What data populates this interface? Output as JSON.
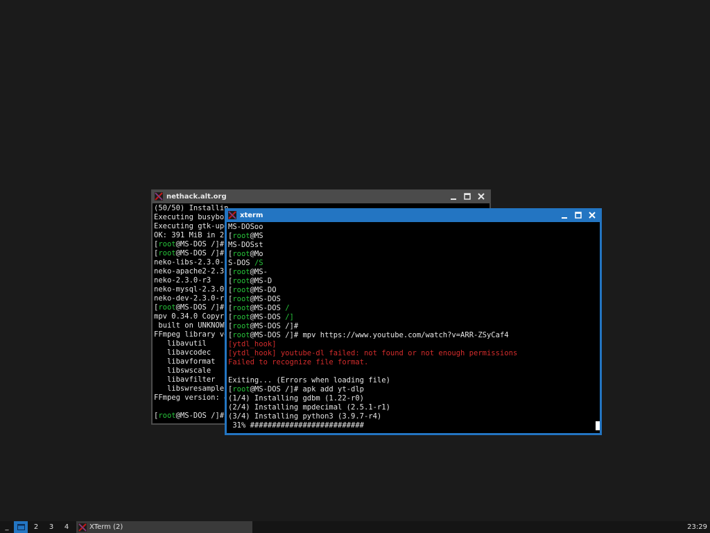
{
  "windows": {
    "back": {
      "title": "nethack.alt.org",
      "lines": [
        [
          {
            "t": "(50/50) Installin"
          }
        ],
        [
          {
            "t": "Executing busybox"
          }
        ],
        [
          {
            "t": "Executing gtk-upd"
          }
        ],
        [
          {
            "t": "OK: 391 MiB in 21"
          }
        ],
        [
          {
            "t": "["
          },
          {
            "t": "root",
            "c": "g"
          },
          {
            "t": "@MS-DOS /]#"
          }
        ],
        [
          {
            "t": "["
          },
          {
            "t": "root",
            "c": "g"
          },
          {
            "t": "@MS-DOS /]#"
          }
        ],
        [
          {
            "t": "neko-libs-2.3.0-r"
          }
        ],
        [
          {
            "t": "neko-apache2-2.3."
          }
        ],
        [
          {
            "t": "neko-2.3.0-r3"
          }
        ],
        [
          {
            "t": "neko-mysql-2.3.0-"
          }
        ],
        [
          {
            "t": "neko-dev-2.3.0-r3"
          }
        ],
        [
          {
            "t": "["
          },
          {
            "t": "root",
            "c": "g"
          },
          {
            "t": "@MS-DOS /]#"
          }
        ],
        [
          {
            "t": "mpv 0.34.0 Copyri"
          }
        ],
        [
          {
            "t": " built on UNKNOWN"
          }
        ],
        [
          {
            "t": "FFmpeg library ve"
          }
        ],
        [
          {
            "t": "   libavutil"
          }
        ],
        [
          {
            "t": "   libavcodec"
          }
        ],
        [
          {
            "t": "   libavformat"
          }
        ],
        [
          {
            "t": "   libswscale"
          }
        ],
        [
          {
            "t": "   libavfilter"
          }
        ],
        [
          {
            "t": "   libswresample"
          }
        ],
        [
          {
            "t": "FFmpeg version: 4"
          }
        ],
        [
          {
            "t": ""
          }
        ],
        [
          {
            "t": "["
          },
          {
            "t": "root",
            "c": "g"
          },
          {
            "t": "@MS-DOS /]#"
          }
        ]
      ]
    },
    "front": {
      "title": "xterm",
      "lines": [
        [
          {
            "t": "MS-DOSoo"
          }
        ],
        [
          {
            "t": "["
          },
          {
            "t": "root",
            "c": "g"
          },
          {
            "t": "@MS"
          }
        ],
        [
          {
            "t": "MS-DOSst"
          }
        ],
        [
          {
            "t": "["
          },
          {
            "t": "root",
            "c": "g"
          },
          {
            "t": "@Mo"
          }
        ],
        [
          {
            "t": "S-DOS "
          },
          {
            "t": "/S",
            "c": "g"
          }
        ],
        [
          {
            "t": "["
          },
          {
            "t": "root",
            "c": "g"
          },
          {
            "t": "@MS-"
          }
        ],
        [
          {
            "t": "["
          },
          {
            "t": "root",
            "c": "g"
          },
          {
            "t": "@MS-D"
          }
        ],
        [
          {
            "t": "["
          },
          {
            "t": "root",
            "c": "g"
          },
          {
            "t": "@MS-DO"
          }
        ],
        [
          {
            "t": "["
          },
          {
            "t": "root",
            "c": "g"
          },
          {
            "t": "@MS-DOS"
          }
        ],
        [
          {
            "t": "["
          },
          {
            "t": "root",
            "c": "g"
          },
          {
            "t": "@MS-DOS "
          },
          {
            "t": "/",
            "c": "g"
          }
        ],
        [
          {
            "t": "["
          },
          {
            "t": "root",
            "c": "g"
          },
          {
            "t": "@MS-DOS "
          },
          {
            "t": "/]",
            "c": "g"
          }
        ],
        [
          {
            "t": "["
          },
          {
            "t": "root",
            "c": "g"
          },
          {
            "t": "@MS-DOS /]#"
          }
        ],
        [
          {
            "t": "["
          },
          {
            "t": "root",
            "c": "g"
          },
          {
            "t": "@MS-DOS /]# mpv https://www.youtube.com/watch?v=ARR-ZSyCaf4"
          }
        ],
        [
          {
            "t": "[ytdl_hook]",
            "c": "r"
          }
        ],
        [
          {
            "t": "[ytdl_hook] youtube-dl failed: not found or not enough permissions",
            "c": "r"
          }
        ],
        [
          {
            "t": "Failed to recognize file format.",
            "c": "r"
          }
        ],
        [
          {
            "t": ""
          }
        ],
        [
          {
            "t": "Exiting... (Errors when loading file)"
          }
        ],
        [
          {
            "t": "["
          },
          {
            "t": "root",
            "c": "g"
          },
          {
            "t": "@MS-DOS /]# apk add yt-dlp"
          }
        ],
        [
          {
            "t": "(1/4) Installing gdbm (1.22-r0)"
          }
        ],
        [
          {
            "t": "(2/4) Installing mpdecimal (2.5.1-r1)"
          }
        ],
        [
          {
            "t": "(3/4) Installing python3 (3.9.7-r4)"
          }
        ],
        [
          {
            "t": " 31% ##########################"
          }
        ]
      ]
    }
  },
  "taskbar": {
    "minimize_label": "_",
    "workspaces": [
      {
        "label": "",
        "active": true,
        "icon": "window-icon"
      },
      {
        "label": "2",
        "active": false
      },
      {
        "label": "3",
        "active": false
      },
      {
        "label": "4",
        "active": false
      }
    ],
    "task_label": "XTerm (2)",
    "clock": "23:29"
  },
  "colors": {
    "desktop": "#1b1b1b",
    "active_border": "#2375c2",
    "inactive_border": "#4b4b4b",
    "prompt_user": "#27c43a",
    "error_text": "#d42c2c"
  },
  "icons": {
    "app_icon": "x11-icon",
    "minimize": "minimize-icon",
    "maximize": "maximize-icon",
    "close": "close-icon"
  }
}
